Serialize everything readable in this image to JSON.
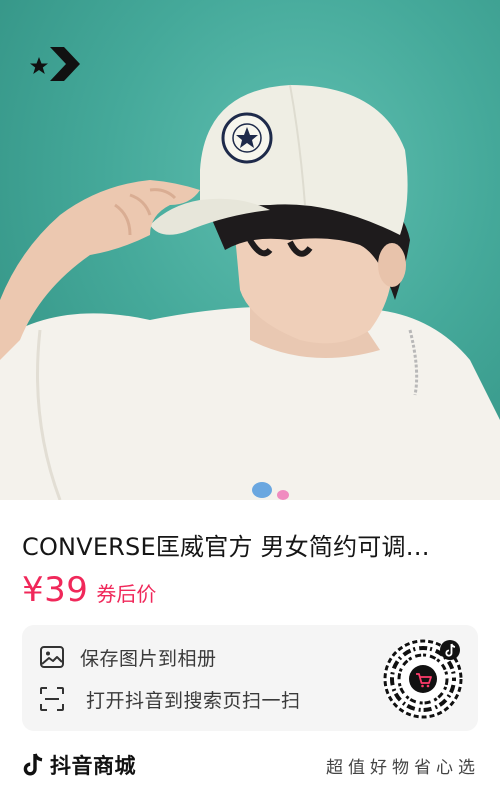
{
  "product": {
    "title": "CONVERSE匡威官方 男女简约可调…",
    "price": "¥39",
    "price_suffix": "券后价"
  },
  "hero": {
    "background_color": "#45a99a",
    "logo_icon": "converse-star-chevron-logo"
  },
  "actions": {
    "save_label": "保存图片到相册",
    "save_icon": "image-icon",
    "scan_label": "打开抖音到搜索页扫一扫",
    "scan_icon": "scan-icon"
  },
  "qr": {
    "center_icon": "shopping-cart-icon",
    "badge_icon": "tiktok-note-icon"
  },
  "footer": {
    "brand_name": "抖音商城",
    "brand_icon": "tiktok-note-icon",
    "slogan": "超值好物省心选"
  },
  "colors": {
    "price": "#f0285a",
    "card_bg": "#f5f5f5",
    "text": "#1f1f1f"
  }
}
